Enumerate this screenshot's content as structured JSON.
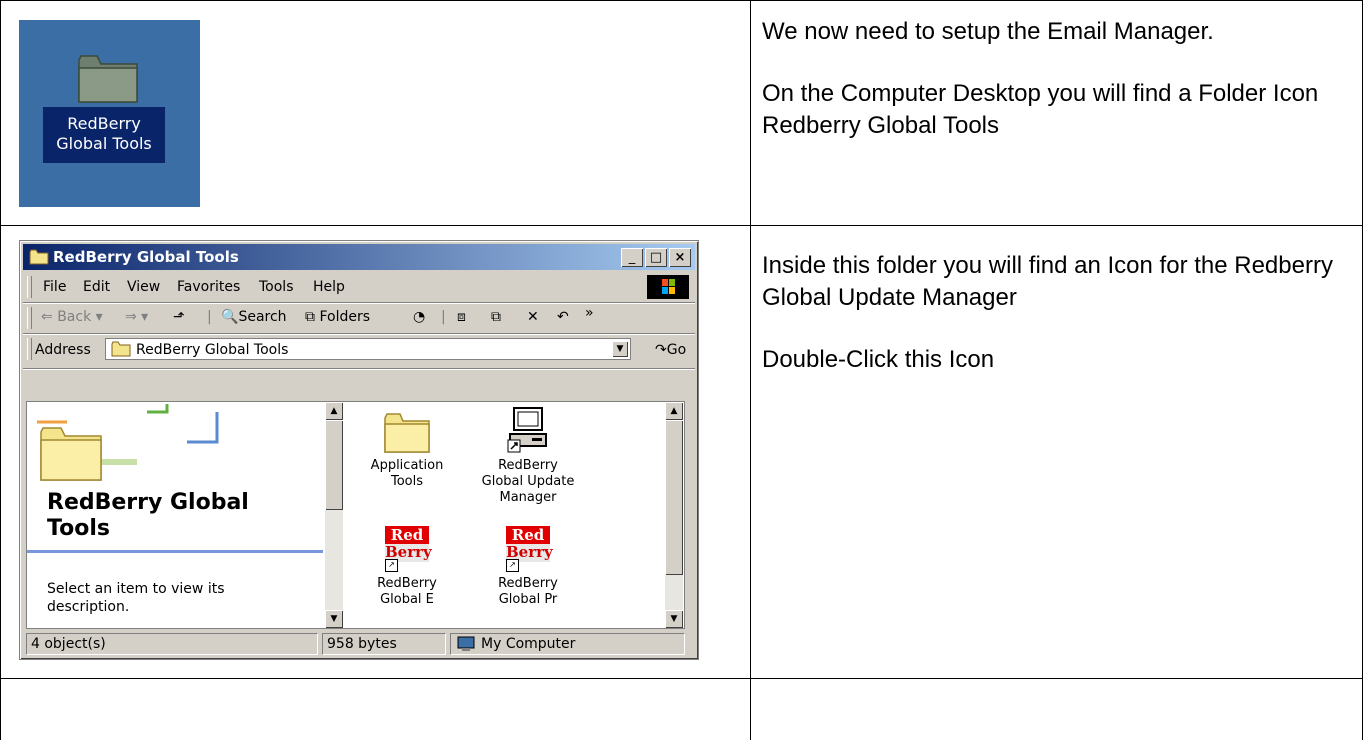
{
  "desktop": {
    "folder_label_line1": "RedBerry",
    "folder_label_line2": "Global Tools"
  },
  "instructions": {
    "row1_p1": "We now need to setup the Email Manager.",
    "row1_p2": "On the Computer Desktop you will find a Folder Icon Redberry Global Tools",
    "row2_p1": "Inside this folder you will find an Icon for the Redberry Global Update Manager",
    "row2_p2": "Double-Click this Icon"
  },
  "window": {
    "title": "RedBerry Global Tools",
    "minimize": "_",
    "maximize": "□",
    "close": "×",
    "menu": [
      "File",
      "Edit",
      "View",
      "Favorites",
      "Tools",
      "Help"
    ],
    "toolbar": {
      "back": "Back",
      "search": "Search",
      "folders": "Folders",
      "overflow": "»"
    },
    "address_label": "Address",
    "address_value": "RedBerry Global Tools",
    "go_label": "Go",
    "left_pane": {
      "title_line1": "RedBerry Global",
      "title_line2": "Tools",
      "desc_line1": "Select an item to view its",
      "desc_line2": "description."
    },
    "items": [
      {
        "line1": "Application",
        "line2": "Tools",
        "line3": ""
      },
      {
        "line1": "RedBerry",
        "line2": "Global Update",
        "line3": "Manager"
      },
      {
        "line1": "RedBerry",
        "line2": "Global E",
        "line3": ""
      },
      {
        "line1": "RedBerry",
        "line2": "Global Pr",
        "line3": ""
      }
    ],
    "redberry_icon_top": "Red",
    "redberry_icon_bottom": "Berry",
    "status": {
      "objects": "4 object(s)",
      "size": "958 bytes",
      "zone": "My Computer"
    }
  },
  "colors": {
    "desktop_bg": "#3a6ea5",
    "title_bar_start": "#0a246a",
    "title_bar_end": "#a6caf0",
    "window_face": "#d4d0c8",
    "folder_yellow": "#f4e48c",
    "redberry_red": "#e00000"
  }
}
